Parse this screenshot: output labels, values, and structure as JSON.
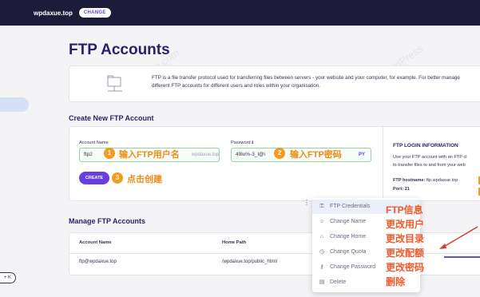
{
  "topbar": {
    "domain": "wpdaxue.top",
    "change_label": "CHANGE"
  },
  "sidebar": {
    "shortcut": "+ K"
  },
  "page_title": "FTP Accounts",
  "intro": {
    "line1": "FTP is a file transfer protocol used for transferring files between servers - your website and your computer, for example. For better manage",
    "line2": "different FTP accounts for different users and roles within your organisation."
  },
  "create": {
    "section_title": "Create New FTP Account",
    "account_label": "Account Name",
    "account_value": "ftp2",
    "account_suffix": "wpdaxue.top",
    "password_label": "Password",
    "password_value": "49lu%-3_l@i",
    "password_suffix": "PY",
    "button_label": "CREATE",
    "annotations": {
      "step1": "1",
      "label1": "输入FTP用户名",
      "step2": "2",
      "label2": "输入FTP密码",
      "step3": "3",
      "label3": "点击创建"
    }
  },
  "login_info": {
    "title": "FTP LOGIN INFORMATION",
    "line1": "Use your FTP account with an FTP cl",
    "line2": "to transfer files to and from your web",
    "hostname_label": "FTP hostname:",
    "hostname_value": "ftp.wpdaxue.top",
    "port_label": "Port:",
    "port_value": "21"
  },
  "manage": {
    "section_title": "Manage FTP Accounts",
    "columns": [
      "Account Name",
      "Home Path"
    ],
    "rows": [
      {
        "account": "ftp@wpdaxue.top",
        "path": "/wpdaxue.top/public_html/"
      }
    ]
  },
  "menu": {
    "items": [
      {
        "label": "FTP Credentials",
        "icon": "key-icon"
      },
      {
        "label": "Change Name",
        "icon": "user-icon"
      },
      {
        "label": "Change Home",
        "icon": "home-icon"
      },
      {
        "label": "Change Quota",
        "icon": "quota-icon"
      },
      {
        "label": "Change Password",
        "icon": "lock-icon"
      },
      {
        "label": "Delete",
        "icon": "trash-icon"
      }
    ],
    "annotations": [
      "FTP信息",
      "更改用户",
      "更改目录",
      "更改配额",
      "更改密码",
      "删除"
    ]
  },
  "colors": {
    "accent": "#673de6",
    "annotation_orange": "#ef8c15",
    "annotation_red": "#f15a2a",
    "topbar": "#1d1b3a"
  }
}
